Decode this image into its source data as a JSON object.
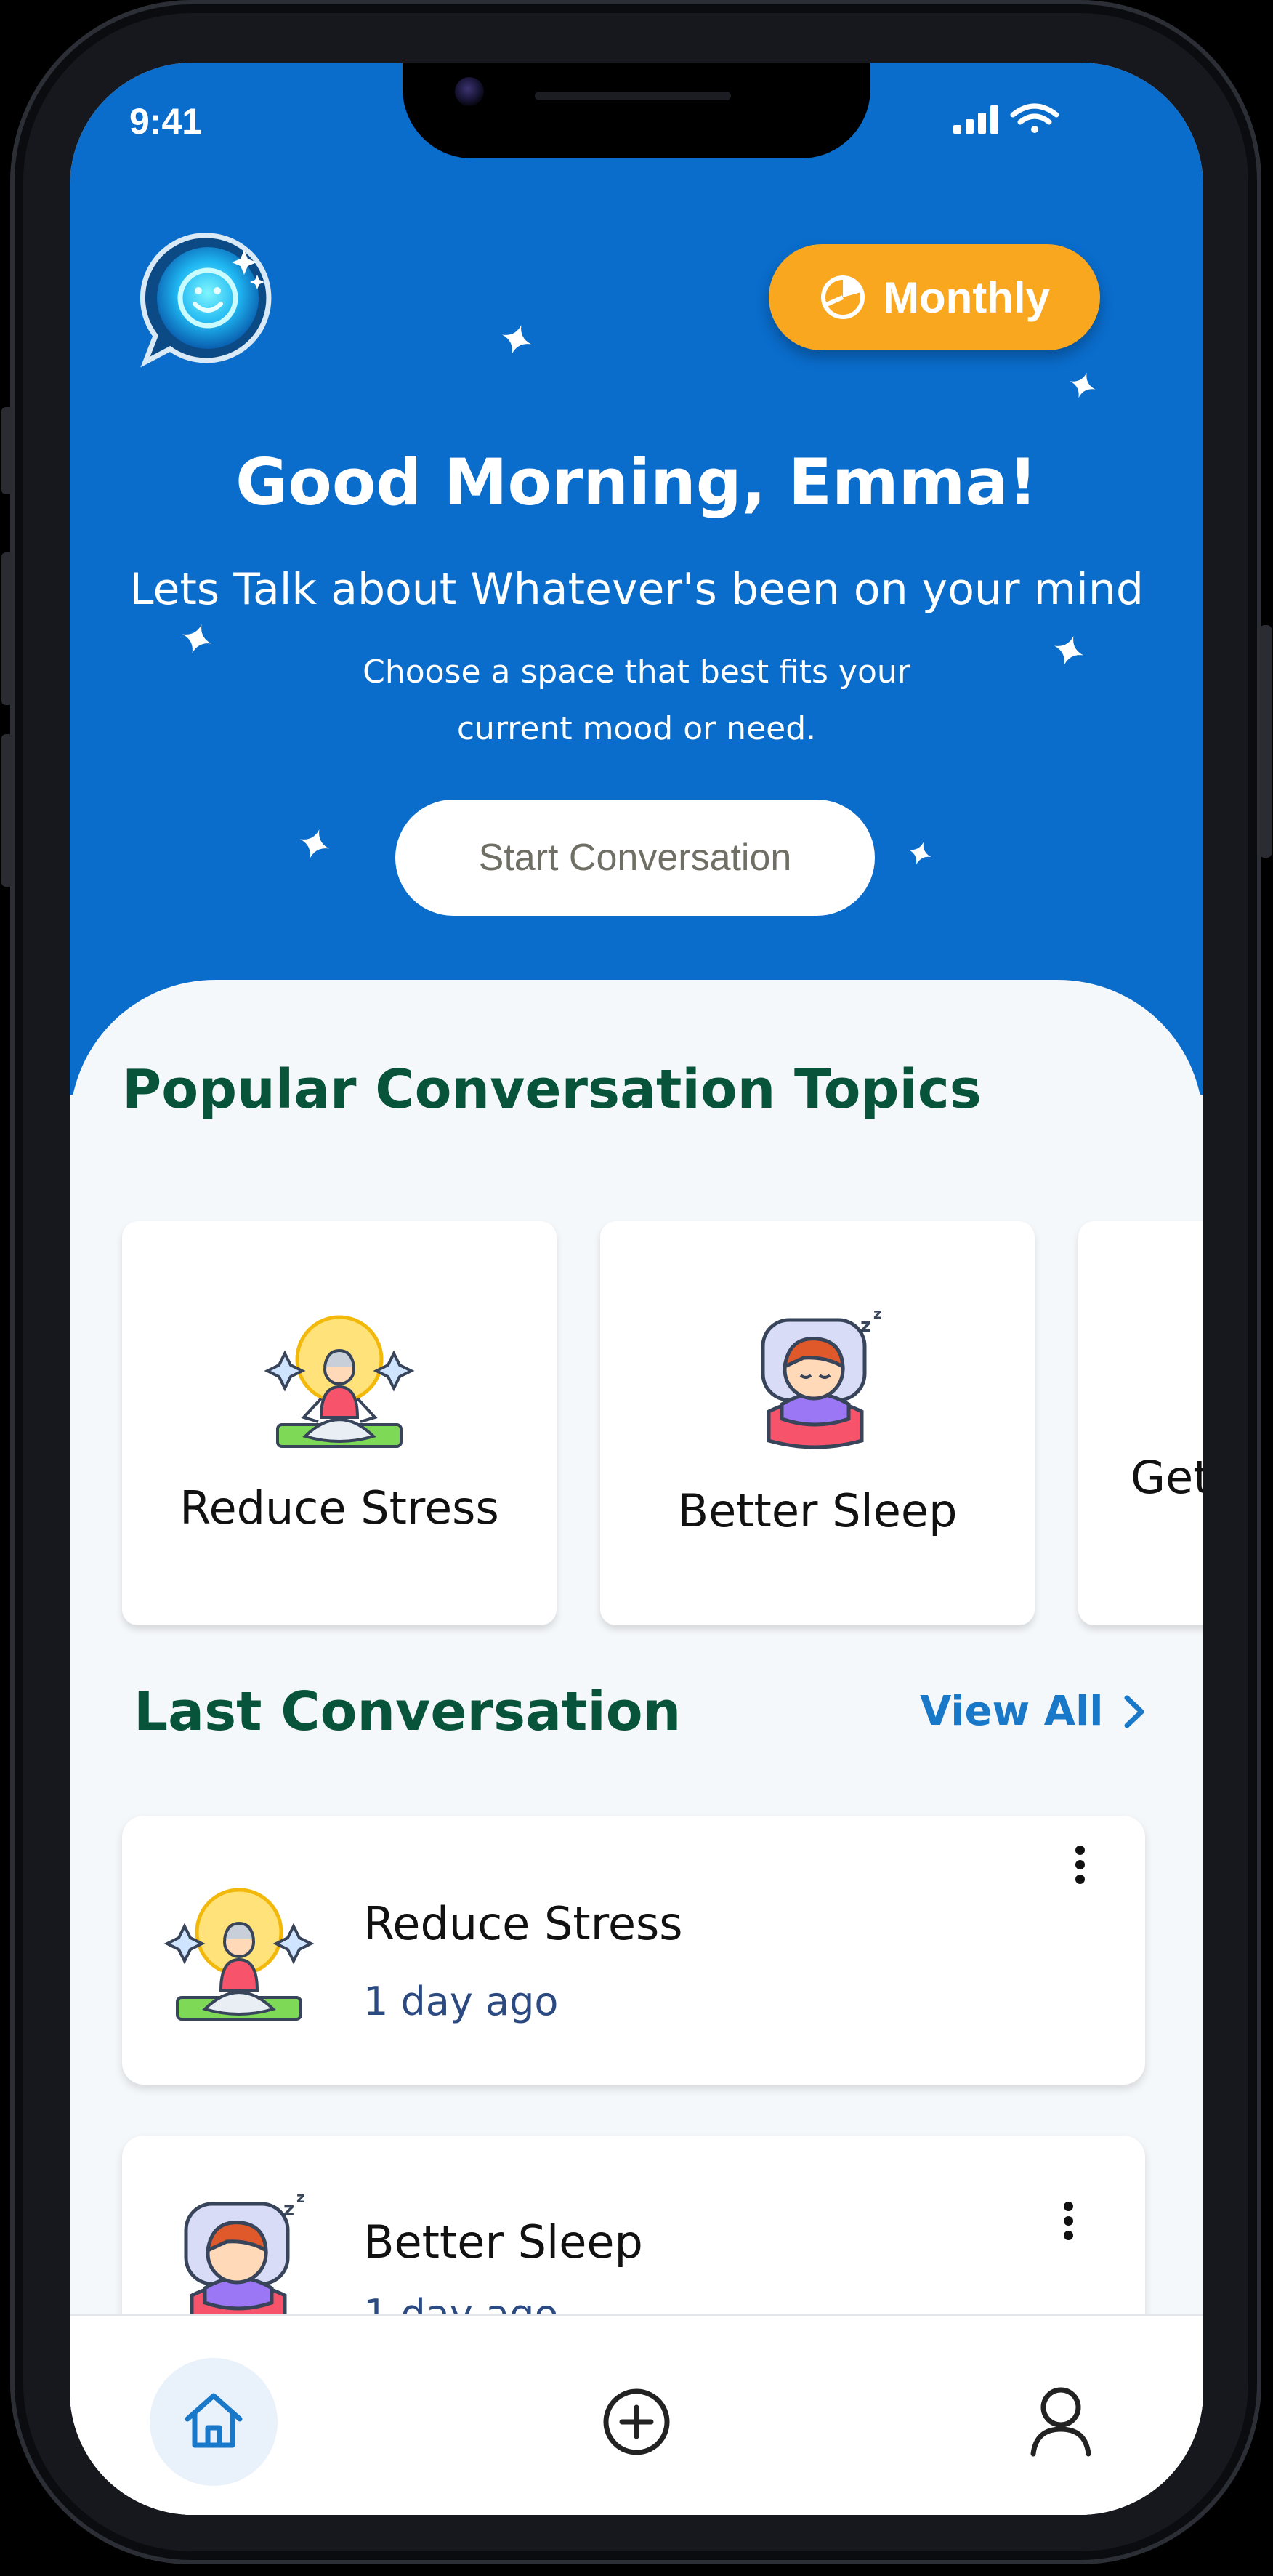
{
  "status_bar": {
    "time": "9:41"
  },
  "header": {
    "plan_button_label": "Monthly",
    "greeting": "Good Morning, Emma!",
    "subtitle": "Lets Talk about Whatever's been on your mind",
    "description": "Choose a space that best fits your current mood or need.",
    "start_button_label": "Start Conversation"
  },
  "popular": {
    "title": "Popular Conversation Topics",
    "topics": [
      {
        "label": "Reduce Stress",
        "icon": "meditation-icon"
      },
      {
        "label": "Better Sleep",
        "icon": "sleeping-icon"
      },
      {
        "label": "Get",
        "icon": ""
      }
    ]
  },
  "last_conversation": {
    "title": "Last Conversation",
    "view_all_label": "View All",
    "items": [
      {
        "title": "Reduce Stress",
        "time": "1 day ago",
        "icon": "meditation-icon"
      },
      {
        "title": "Better Sleep",
        "time": "1 day ago",
        "icon": "sleeping-icon"
      }
    ]
  },
  "bottom_nav": [
    {
      "name": "home",
      "icon": "home-icon",
      "active": true
    },
    {
      "name": "add",
      "icon": "plus-circle-icon",
      "active": false
    },
    {
      "name": "profile",
      "icon": "user-icon",
      "active": false
    }
  ],
  "colors": {
    "hero_blue": "#0a6ccb",
    "accent_orange": "#f9a71f",
    "heading_green": "#07543a",
    "link_blue": "#1a78c8"
  }
}
